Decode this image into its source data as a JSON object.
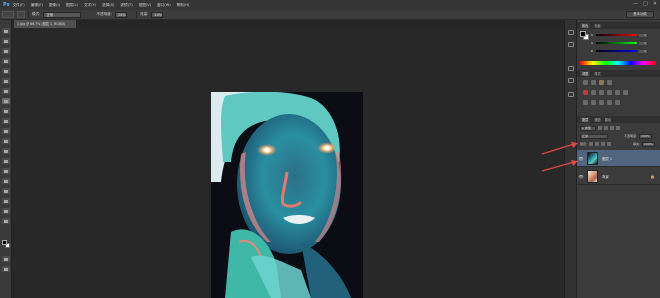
{
  "app": {
    "logo": "Ps"
  },
  "menu": {
    "items": [
      "文件(F)",
      "编辑(E)",
      "图像(I)",
      "图层(L)",
      "文字(Y)",
      "选择(S)",
      "滤镜(T)",
      "视图(V)",
      "窗口(W)",
      "帮助(H)"
    ],
    "window_controls": [
      "—",
      "□",
      "✕"
    ]
  },
  "options": {
    "mode_label": "模式:",
    "mode_value": "正常",
    "opacity_label": "不透明度:",
    "opacity_value": "24%",
    "flow_label": "流量:",
    "flow_value": "24%",
    "workspace": "基本功能"
  },
  "document": {
    "tab_title": "1.jpg @ 66.7% (图层 1, RGB/8)"
  },
  "panels": {
    "color_tabs": [
      "颜色",
      "色板"
    ],
    "color_sliders": [
      {
        "label": "R",
        "value": "0"
      },
      {
        "label": "G",
        "value": "0"
      },
      {
        "label": "B",
        "value": "0"
      }
    ],
    "adjust_tabs": [
      "调整",
      "样式"
    ],
    "layer_tabs": [
      "图层",
      "通道",
      "路径"
    ],
    "kind_filter": "ρ 类型",
    "blend_mode": "正常",
    "opacity_label": "不透明度:",
    "opacity_value": "100%",
    "lock_label": "锁定:",
    "fill_label": "填充:",
    "fill_value": "100%",
    "layers": [
      {
        "name": "图层 1",
        "active": true
      },
      {
        "name": "背景",
        "active": false,
        "locked": true
      }
    ],
    "eye_glyph": "👁",
    "lock_glyph": "🔒"
  },
  "colors": {
    "accent_arrow": "#e04646",
    "active_layer": "#52657e"
  }
}
